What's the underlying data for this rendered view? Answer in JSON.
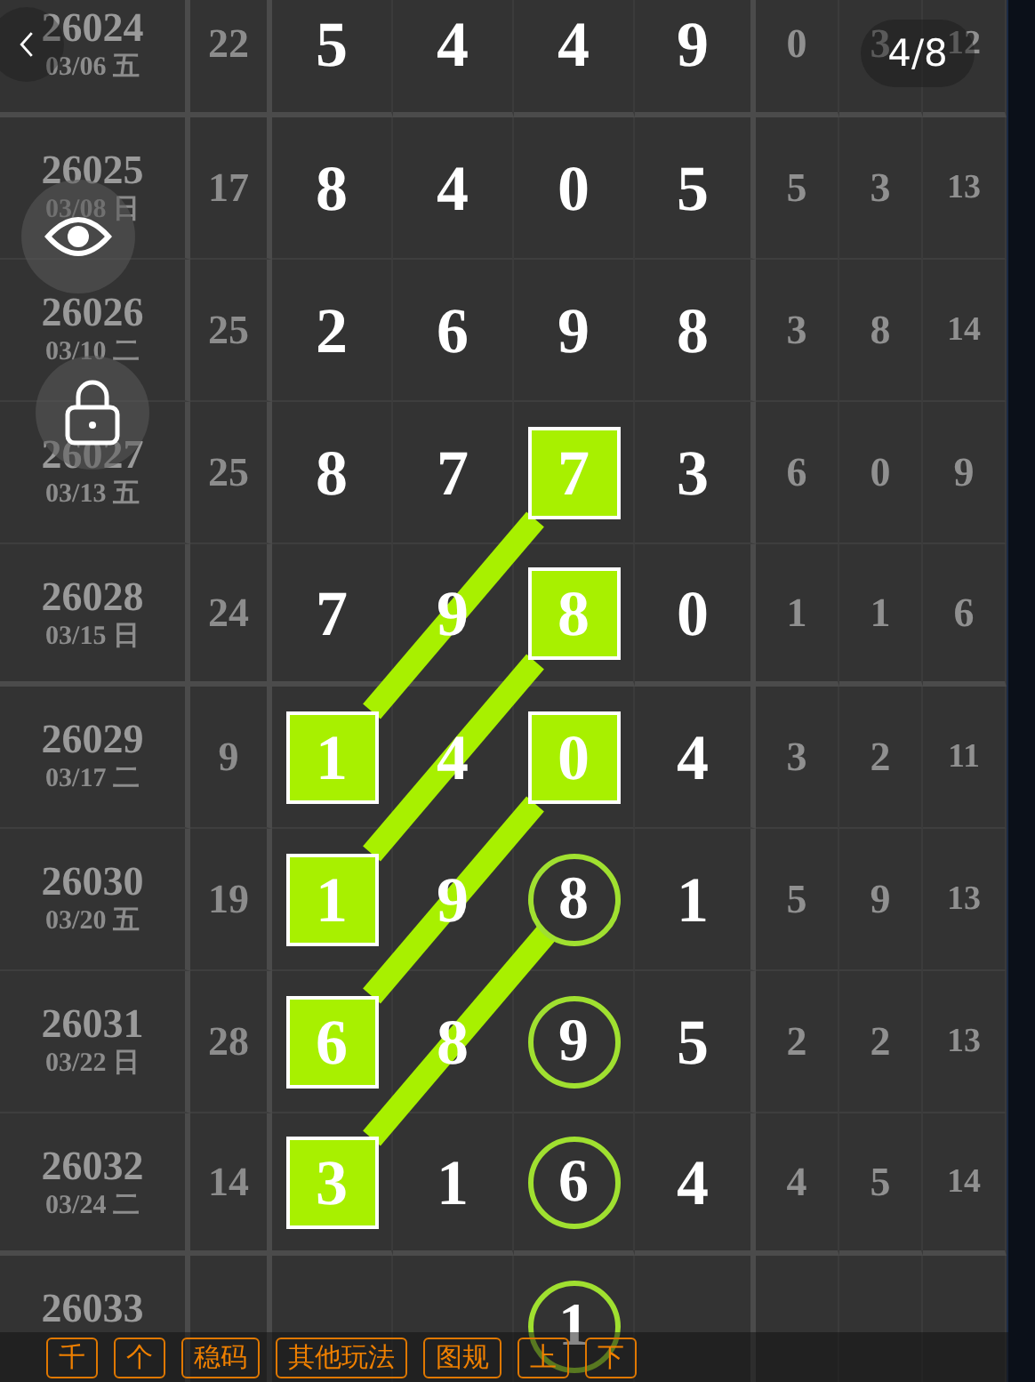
{
  "page_indicator": "4/8",
  "table": {
    "rows": [
      {
        "issue": "26024",
        "date": "03/06 五",
        "sum": "22",
        "digits": [
          {
            "value": "5",
            "kind": "plain"
          },
          {
            "value": "4",
            "kind": "plain"
          },
          {
            "value": "4",
            "kind": "plain"
          },
          {
            "value": "9",
            "kind": "plain"
          }
        ],
        "extras": [
          "0",
          "3",
          "12"
        ]
      },
      {
        "issue": "26025",
        "date": "03/08 日",
        "sum": "17",
        "digits": [
          {
            "value": "8",
            "kind": "plain"
          },
          {
            "value": "4",
            "kind": "plain"
          },
          {
            "value": "0",
            "kind": "plain"
          },
          {
            "value": "5",
            "kind": "plain"
          }
        ],
        "extras": [
          "5",
          "3",
          "13"
        ]
      },
      {
        "issue": "26026",
        "date": "03/10 二",
        "sum": "25",
        "digits": [
          {
            "value": "2",
            "kind": "plain"
          },
          {
            "value": "6",
            "kind": "plain"
          },
          {
            "value": "9",
            "kind": "plain"
          },
          {
            "value": "8",
            "kind": "plain"
          }
        ],
        "extras": [
          "3",
          "8",
          "14"
        ]
      },
      {
        "issue": "26027",
        "date": "03/13 五",
        "sum": "25",
        "digits": [
          {
            "value": "8",
            "kind": "plain"
          },
          {
            "value": "7",
            "kind": "plain"
          },
          {
            "value": "7",
            "kind": "square"
          },
          {
            "value": "3",
            "kind": "plain"
          }
        ],
        "extras": [
          "6",
          "0",
          "9"
        ]
      },
      {
        "issue": "26028",
        "date": "03/15 日",
        "sum": "24",
        "digits": [
          {
            "value": "7",
            "kind": "plain"
          },
          {
            "value": "9",
            "kind": "plain"
          },
          {
            "value": "8",
            "kind": "square"
          },
          {
            "value": "0",
            "kind": "plain"
          }
        ],
        "extras": [
          "1",
          "1",
          "6"
        ]
      },
      {
        "issue": "26029",
        "date": "03/17 二",
        "sum": "9",
        "digits": [
          {
            "value": "1",
            "kind": "square"
          },
          {
            "value": "4",
            "kind": "plain"
          },
          {
            "value": "0",
            "kind": "square"
          },
          {
            "value": "4",
            "kind": "plain"
          }
        ],
        "extras": [
          "3",
          "2",
          "11"
        ]
      },
      {
        "issue": "26030",
        "date": "03/20 五",
        "sum": "19",
        "digits": [
          {
            "value": "1",
            "kind": "square"
          },
          {
            "value": "9",
            "kind": "plain"
          },
          {
            "value": "8",
            "kind": "circle"
          },
          {
            "value": "1",
            "kind": "plain"
          }
        ],
        "extras": [
          "5",
          "9",
          "13"
        ]
      },
      {
        "issue": "26031",
        "date": "03/22 日",
        "sum": "28",
        "digits": [
          {
            "value": "6",
            "kind": "square"
          },
          {
            "value": "8",
            "kind": "plain"
          },
          {
            "value": "9",
            "kind": "circle"
          },
          {
            "value": "5",
            "kind": "plain"
          }
        ],
        "extras": [
          "2",
          "2",
          "13"
        ]
      },
      {
        "issue": "26032",
        "date": "03/24 二",
        "sum": "14",
        "digits": [
          {
            "value": "3",
            "kind": "square"
          },
          {
            "value": "1",
            "kind": "plain"
          },
          {
            "value": "6",
            "kind": "circle"
          },
          {
            "value": "4",
            "kind": "plain"
          }
        ],
        "extras": [
          "4",
          "5",
          "14"
        ]
      },
      {
        "issue": "26033",
        "digits": [
          {
            "kind": "empty"
          },
          {
            "kind": "empty"
          },
          {
            "value": "1",
            "kind": "circle"
          },
          {
            "kind": "empty"
          }
        ]
      }
    ]
  },
  "toolbar": {
    "buttons": [
      "千",
      "个",
      "稳码",
      "其他玩法",
      "图规",
      "上",
      "下"
    ]
  }
}
